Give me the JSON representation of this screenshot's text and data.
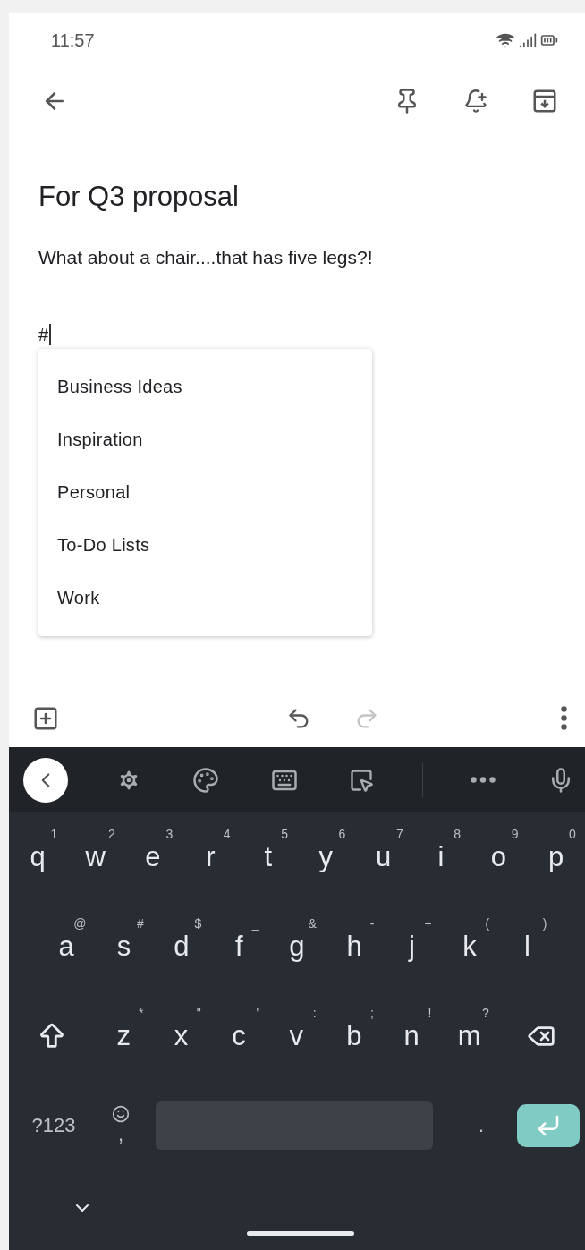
{
  "status_bar": {
    "time": "11:57"
  },
  "note": {
    "title": "For Q3 proposal",
    "body": "What about a chair....that has five legs?!",
    "tag_input": "#"
  },
  "label_suggestions": [
    "Business Ideas",
    "Inspiration",
    "Personal",
    "To-Do Lists",
    "Work"
  ],
  "bottom_toolbar": {
    "undo": {
      "disabled": false
    },
    "redo": {
      "disabled": true
    }
  },
  "keyboard": {
    "rows": [
      [
        {
          "letter": "q",
          "hint": "1"
        },
        {
          "letter": "w",
          "hint": "2"
        },
        {
          "letter": "e",
          "hint": "3"
        },
        {
          "letter": "r",
          "hint": "4"
        },
        {
          "letter": "t",
          "hint": "5"
        },
        {
          "letter": "y",
          "hint": "6"
        },
        {
          "letter": "u",
          "hint": "7"
        },
        {
          "letter": "i",
          "hint": "8"
        },
        {
          "letter": "o",
          "hint": "9"
        },
        {
          "letter": "p",
          "hint": "0"
        }
      ],
      [
        {
          "letter": "a",
          "hint": "@"
        },
        {
          "letter": "s",
          "hint": "#"
        },
        {
          "letter": "d",
          "hint": "$"
        },
        {
          "letter": "f",
          "hint": "_"
        },
        {
          "letter": "g",
          "hint": "&"
        },
        {
          "letter": "h",
          "hint": "-"
        },
        {
          "letter": "j",
          "hint": "+"
        },
        {
          "letter": "k",
          "hint": "("
        },
        {
          "letter": "l",
          "hint": ")"
        }
      ],
      [
        {
          "letter": "z",
          "hint": "*"
        },
        {
          "letter": "x",
          "hint": "\""
        },
        {
          "letter": "c",
          "hint": "'"
        },
        {
          "letter": "v",
          "hint": ":"
        },
        {
          "letter": "b",
          "hint": ";"
        },
        {
          "letter": "n",
          "hint": "!"
        },
        {
          "letter": "m",
          "hint": "?"
        }
      ]
    ],
    "symbols_key": "?123",
    "comma_key": ",",
    "period_key": "."
  }
}
